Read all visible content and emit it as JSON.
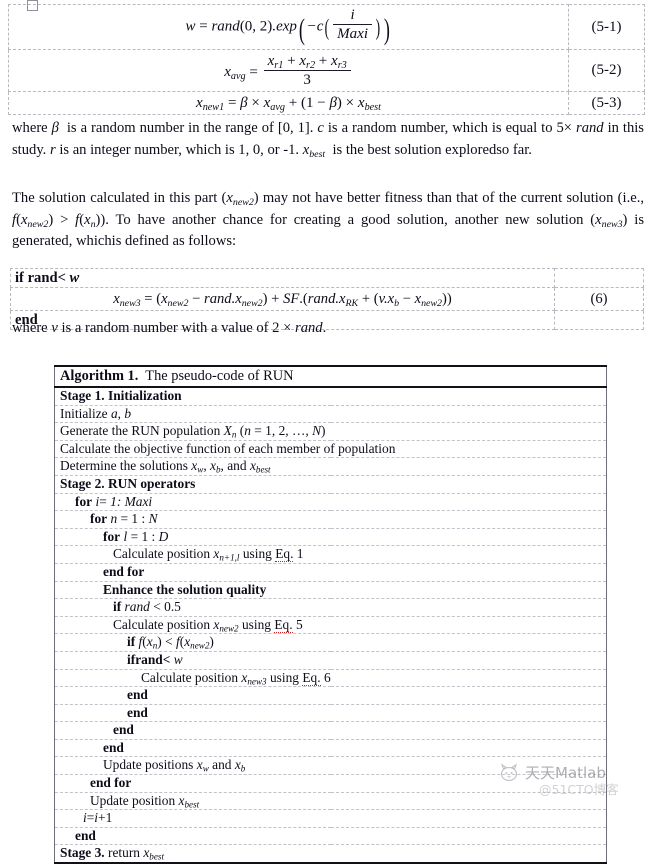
{
  "document": {
    "type": "academic-paper-page",
    "equations_table": {
      "rows": [
        {
          "number": "(5-1)",
          "plain": "w = rand(0, 2).exp(-c(i/Maxi))",
          "parts": {
            "lhs": "w",
            "eq": "=",
            "rand": "rand",
            "args": "(0, 2)",
            "dotexp": ".exp",
            "minus_c": "−c",
            "frac_num": "i",
            "frac_den": "Maxi"
          }
        },
        {
          "number": "(5-2)",
          "plain": "x_avg = (x_r1 + x_r2 + x_r3) / 3",
          "parts": {
            "lhs": "x",
            "lhs_sub": "avg",
            "eq": "=",
            "num_t1": "x",
            "num_t1_sub": "r1",
            "plus1": "+",
            "num_t2": "x",
            "num_t2_sub": "r2",
            "plus2": "+",
            "num_t3": "x",
            "num_t3_sub": "r3",
            "den": "3"
          }
        },
        {
          "number": "(5-3)",
          "plain": "x_new1 = β × x_avg + (1 − β) × x_best",
          "parts": {
            "lhs": "x",
            "lhs_sub": "new1",
            "eq": "=",
            "beta": "β",
            "times1": "×",
            "t1": "x",
            "t1_sub": "avg",
            "plus": "+",
            "open": "(1 − ",
            "beta2": "β",
            "close": ")",
            "times2": "×",
            "t2": "x",
            "t2_sub": "best"
          }
        }
      ]
    },
    "paragraph_where": {
      "p1": "where ",
      "beta": "β",
      "p2": " is a random number in the range of [0, 1]. ",
      "c": "c",
      "p3": " is a random number, which is equal to ",
      "five": "5",
      "times": "×",
      "rand": "rand",
      "p4": " in this study. ",
      "r": "r",
      "p5": " is an integer number, which is 1, 0, or -1. ",
      "xbest": "x",
      "xbest_sub": "best",
      "p6": " is the best solution exploredso far."
    },
    "paragraph_solution": {
      "p1": "The solution calculated in this part (",
      "x1": "x",
      "x1_sub": "new2",
      "p2": ") may not have better fitness than that of the current solution (i.e., ",
      "f1": "f",
      "p3": "(",
      "x2": "x",
      "x2_sub": "new2",
      "p4": ") > ",
      "f2": "f",
      "p5": "(",
      "x3": "x",
      "x3_sub": "n",
      "p6": ")). To have another chance for creating a good solution, another new solution (",
      "x4": "x",
      "x4_sub": "new3",
      "p7": ") is generated, whichis defined as follows:"
    },
    "equation6_table": {
      "line_if": {
        "if": "if rand",
        "lt": "< ",
        "w": "w"
      },
      "number": "(6)",
      "equation": {
        "lhs": "x",
        "lhs_sub": "new3",
        "eq": "=",
        "open1": "(",
        "t1": "x",
        "t1_sub": "new2",
        "minus": "−",
        "rand1": "rand.",
        "t2": "x",
        "t2_sub": "new2",
        "close1": ")",
        "plus": "+",
        "sf": "SF",
        "dot": ".(",
        "rand2": "rand.",
        "t3": "x",
        "t3_sub": "RK",
        "plus2": "+",
        "open2": "(",
        "v": "v.",
        "t4": "x",
        "t4_sub": "b",
        "minus2": "−",
        "t5": "x",
        "t5_sub": "new2",
        "close2": "))"
      },
      "line_end": "end"
    },
    "paragraph_v": {
      "p1": "where ",
      "v": "v",
      "p2": " is a random number with a value of 2 ",
      "times": "×",
      "rand": "rand",
      "p3": "."
    },
    "algorithm": {
      "header": {
        "label": "Algorithm 1.",
        "title": "The pseudo-code of RUN"
      },
      "lines": [
        {
          "id": "stage1",
          "indent": 0,
          "bold_prefix": "Stage 1. Initialization",
          "rest": ""
        },
        {
          "id": "init-ab",
          "indent": 0,
          "bold_prefix": "",
          "rest": "Initialize a, b"
        },
        {
          "id": "gen-pop",
          "indent": 0,
          "bold_prefix": "",
          "rest": "Generate the RUN population Xn (n = 1, 2, …, N)"
        },
        {
          "id": "calc-obj",
          "indent": 0,
          "bold_prefix": "",
          "rest": "Calculate the objective function of each member of population"
        },
        {
          "id": "determine",
          "indent": 0,
          "bold_prefix": "",
          "rest": "Determine the solutions xw, xb, and xbest"
        },
        {
          "id": "stage2",
          "indent": 0,
          "bold_prefix": "Stage 2. RUN operators",
          "rest": ""
        },
        {
          "id": "for-i",
          "indent": 1,
          "bold_prefix": "for",
          "rest": "i= 1: Maxi"
        },
        {
          "id": "for-n",
          "indent": 2,
          "bold_prefix": "for",
          "rest": "n = 1 : N"
        },
        {
          "id": "for-l",
          "indent": 3,
          "bold_prefix": "for",
          "rest": "l = 1 : D"
        },
        {
          "id": "calc-pos-1",
          "indent": 4,
          "bold_prefix": "",
          "rest": "Calculate position xn+1,l using Eq. 1"
        },
        {
          "id": "end-for-1",
          "indent": 3,
          "bold_prefix": "end for",
          "rest": ""
        },
        {
          "id": "enhance",
          "indent": 3,
          "bold_prefix": "Enhance the solution quality",
          "rest": ""
        },
        {
          "id": "if-rand-05",
          "indent": 4,
          "bold_prefix": "if",
          "rest": "rand < 0.5"
        },
        {
          "id": "calc-pos-5",
          "indent": 4,
          "bold_prefix": "",
          "rest": "Calculate position xnew2 using Eq. 5"
        },
        {
          "id": "if-f",
          "indent": 5,
          "bold_prefix": "if",
          "rest": "f(xn) < f(xnew2)"
        },
        {
          "id": "if-rand-w",
          "indent": 5,
          "bold_prefix": "if",
          "rest": "rand< w"
        },
        {
          "id": "calc-pos-6",
          "indent": 6,
          "bold_prefix": "",
          "rest": "Calculate position xnew3 using Eq. 6"
        },
        {
          "id": "end-1",
          "indent": 5,
          "bold_prefix": "end",
          "rest": ""
        },
        {
          "id": "end-2",
          "indent": 5,
          "bold_prefix": "end",
          "rest": ""
        },
        {
          "id": "end-3",
          "indent": 4,
          "bold_prefix": "end",
          "rest": ""
        },
        {
          "id": "end-4",
          "indent": 3,
          "bold_prefix": "end",
          "rest": ""
        },
        {
          "id": "update-wb",
          "indent": 3,
          "bold_prefix": "",
          "rest": "Update positions xw and xb"
        },
        {
          "id": "end-for-2",
          "indent": 2,
          "bold_prefix": "end for",
          "rest": ""
        },
        {
          "id": "update-best",
          "indent": 2,
          "bold_prefix": "",
          "rest": "Update position xbest"
        },
        {
          "id": "i-increment",
          "indent": 1,
          "bold_prefix": "",
          "rest": "i=i+1"
        },
        {
          "id": "end-5",
          "indent": 1,
          "bold_prefix": "end",
          "rest": ""
        },
        {
          "id": "stage3",
          "indent": 0,
          "bold_prefix": "Stage 3.",
          "rest": "return xbest"
        }
      ],
      "labels": {
        "stage1": "Stage 1. Initialization",
        "stage2": "Stage 2. RUN operators",
        "stage3": "Stage 3.",
        "stage3_rest": "return",
        "initialize": "Initialize",
        "generate": "Generate the RUN population",
        "generate_args": "(n = 1, 2, …, N)",
        "calculate_obj": "Calculate the objective function of each member of population",
        "determine": "Determine the solutions",
        "determine_and": ", and",
        "for": "for",
        "for_i_range": "= 1: Maxi",
        "for_n_range": "= 1 : N",
        "for_l_range": "= 1 : D",
        "calc_position": "Calculate position",
        "using": "using",
        "eq1": "Eq.",
        "eq1_num": "1",
        "eq5_num": "5",
        "eq6_num": "6",
        "end_for": "end for",
        "enhance": "Enhance the solution quality",
        "if": "if",
        "if_rand_05": "rand < 0.5",
        "if_rand_w_a": "if",
        "if_rand_w_b": "rand<",
        "end": "end",
        "update_positions": "Update positions",
        "update_position": "Update position",
        "and": "and",
        "i_increment": "=",
        "i_plus": "+1"
      }
    },
    "watermark": {
      "line1": "天天Matlab",
      "line2": "@51CTO博客"
    }
  }
}
